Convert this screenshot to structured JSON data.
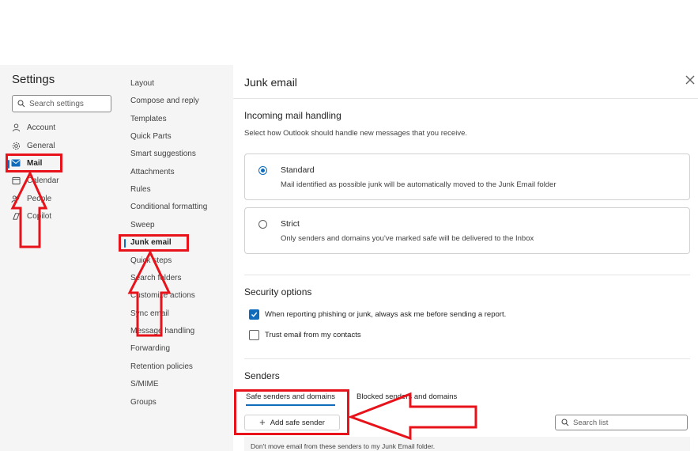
{
  "left_nav": {
    "title": "Settings",
    "search_placeholder": "Search settings",
    "items": [
      {
        "label": "Account",
        "icon": "person-icon"
      },
      {
        "label": "General",
        "icon": "gear-icon"
      },
      {
        "label": "Mail",
        "icon": "mail-icon",
        "active": true
      },
      {
        "label": "Calendar",
        "icon": "calendar-icon"
      },
      {
        "label": "People",
        "icon": "people-icon"
      },
      {
        "label": "Copilot",
        "icon": "copilot-icon"
      }
    ]
  },
  "sub_nav": {
    "items": [
      {
        "label": "Layout"
      },
      {
        "label": "Compose and reply"
      },
      {
        "label": "Templates"
      },
      {
        "label": "Quick Parts"
      },
      {
        "label": "Smart suggestions"
      },
      {
        "label": "Attachments"
      },
      {
        "label": "Rules"
      },
      {
        "label": "Conditional formatting"
      },
      {
        "label": "Sweep"
      },
      {
        "label": "Junk email",
        "active": true
      },
      {
        "label": "Quick steps"
      },
      {
        "label": "Search folders"
      },
      {
        "label": "Customize actions"
      },
      {
        "label": "Sync email"
      },
      {
        "label": "Message handling"
      },
      {
        "label": "Forwarding"
      },
      {
        "label": "Retention policies"
      },
      {
        "label": "S/MIME"
      },
      {
        "label": "Groups"
      }
    ]
  },
  "panel": {
    "title": "Junk email",
    "incoming": {
      "title": "Incoming mail handling",
      "description": "Select how Outlook should handle new messages that you receive.",
      "options": [
        {
          "label": "Standard",
          "description": "Mail identified as possible junk will be automatically moved to the Junk Email folder",
          "selected": true
        },
        {
          "label": "Strict",
          "description": "Only senders and domains you've marked safe will be delivered to the Inbox",
          "selected": false
        }
      ]
    },
    "security": {
      "title": "Security options",
      "options": [
        {
          "label": "When reporting phishing or junk, always ask me before sending a report.",
          "checked": true
        },
        {
          "label": "Trust email from my contacts",
          "checked": false
        }
      ]
    },
    "senders": {
      "title": "Senders",
      "tabs": [
        {
          "label": "Safe senders and domains",
          "active": true
        },
        {
          "label": "Blocked senders and domains",
          "active": false
        }
      ],
      "add_button": "Add safe sender",
      "search_placeholder": "Search list",
      "info": "Don't move email from these senders to my Junk Email folder."
    }
  },
  "colors": {
    "accent": "#0f6cbd",
    "annotation": "#e8121a",
    "nav_bg": "#f5f5f5"
  }
}
